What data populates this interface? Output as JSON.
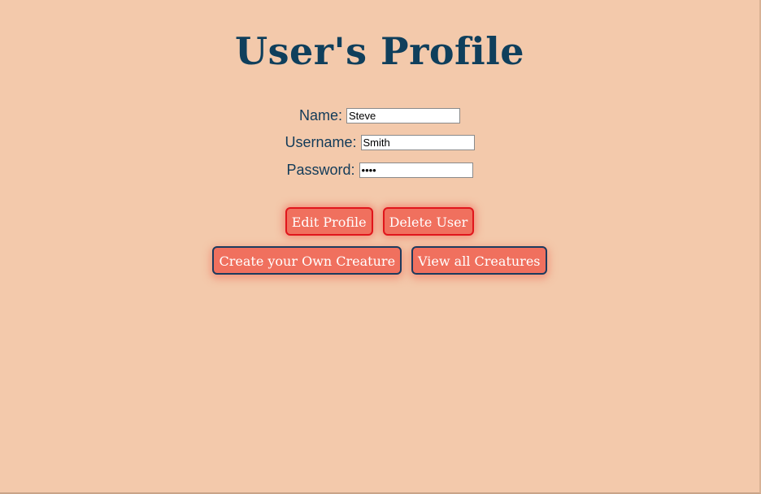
{
  "page": {
    "title": "User's Profile"
  },
  "form": {
    "name_label": "Name:",
    "name_value": "Steve",
    "username_label": "Username:",
    "username_value": "Smith",
    "password_label": "Password:",
    "password_value": "••••"
  },
  "buttons": {
    "edit_profile": "Edit Profile",
    "delete_user": "Delete User",
    "create_creature": "Create your Own Creature",
    "view_creatures": "View all Creatures"
  },
  "colors": {
    "background": "#f3c9ab",
    "title": "#0f3f5c",
    "button_fill": "#f0705e",
    "button_border_red": "#e0161c",
    "button_border_navy": "#1c3b5e"
  }
}
